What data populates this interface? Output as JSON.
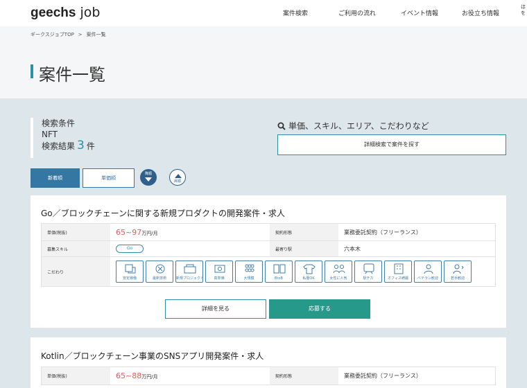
{
  "header": {
    "logo_bold": "geechs",
    "logo_light": " job",
    "nav": [
      "案件検索",
      "ご利用の流れ",
      "イベント情報",
      "お役立ち情報"
    ],
    "nav_cut": "ほ\nを"
  },
  "breadcrumb": {
    "home": "ギークスジョブTOP",
    "sep": ">",
    "current": "案件一覧"
  },
  "page_title": "案件一覧",
  "search": {
    "cond_label": "検索条件",
    "cond_value": "NFT",
    "result_prefix": "検索結果",
    "result_count": "3",
    "result_unit": "件",
    "keyword_hint": "単価、スキル、エリア、こだわりなど",
    "detail_button": "詳細検索で案件を探す"
  },
  "sort": {
    "newest": "新着順",
    "price": "単価順",
    "desc": "降順",
    "asc": "昇順"
  },
  "jobs": [
    {
      "title": "Go／ブロックチェーンに関する新規プロダクトの開発案件・求人",
      "price_label": "単価(税抜)",
      "price": "65~97",
      "price_unit": "万円/月",
      "contract_label": "契約形態",
      "contract": "業務委託契約（フリーランス）",
      "skill_label": "募集スキル",
      "skill": "Go",
      "station_label": "最寄り駅",
      "station": "六本木",
      "kodawari_label": "こだわり",
      "kodawari": [
        "安定稼働",
        "最新技術",
        "新規プロジェクト",
        "高単価",
        "大規模",
        "BtoB",
        "私服OK",
        "女性に人気",
        "駅チカ",
        "オフィス綺麗",
        "ベテラン歓迎",
        "若手歓迎"
      ],
      "see_button": "詳細を見る",
      "apply_button": "応募する"
    },
    {
      "title": "Kotlin／ブロックチェーン事業のSNSアプリ開発案件・求人",
      "price_label": "単価(税抜)",
      "price": "65~88",
      "price_unit": "万円/月",
      "contract_label": "契約形態",
      "contract": "業務委託契約（フリーランス）"
    }
  ],
  "colors": {
    "accent": "#2a90a8",
    "sort_active": "#3577a3",
    "apply": "#26998b",
    "price": "#e85a5a"
  }
}
